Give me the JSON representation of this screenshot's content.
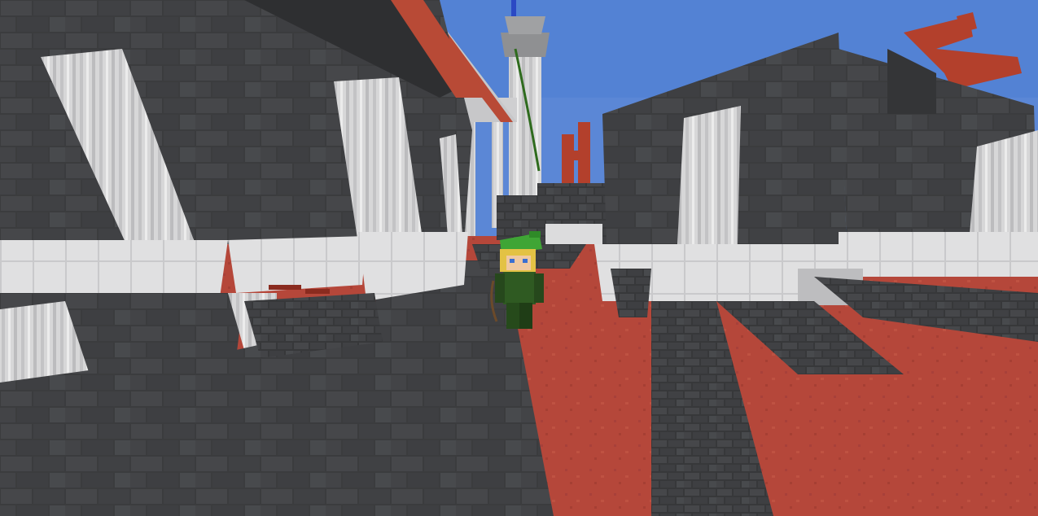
{
  "scene": {
    "type": "minecraft-third-person-view",
    "sky_color": "#5b87d6",
    "floor_color": "#b8493a",
    "brick_color": "#3a3b3d",
    "brick_light": "#4a4b4e",
    "quartz_color": "#d8d8d8",
    "quartz_shadow": "#a9a9ab",
    "banner_color": "#b3402c"
  },
  "player": {
    "hat_color": "#3fa535",
    "tunic_color": "#2f5a22",
    "hair_color": "#e3c244"
  }
}
